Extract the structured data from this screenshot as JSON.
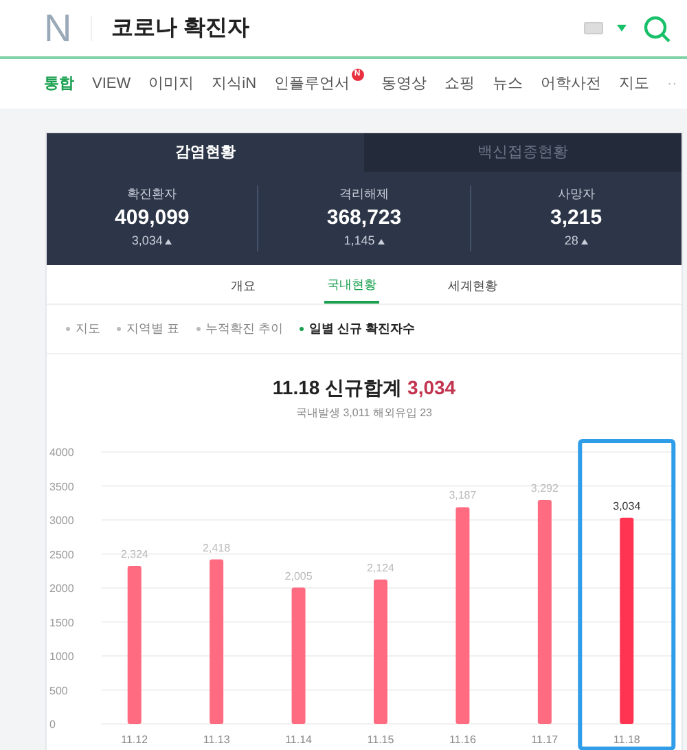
{
  "header": {
    "logo": "N",
    "query": "코로나 확진자"
  },
  "nav_tabs": [
    {
      "label": "통합",
      "selected": true
    },
    {
      "label": "VIEW",
      "selected": false
    },
    {
      "label": "이미지",
      "selected": false
    },
    {
      "label": "지식iN",
      "selected": false
    },
    {
      "label": "인플루언서",
      "selected": false,
      "badge": "N"
    },
    {
      "label": "동영상",
      "selected": false
    },
    {
      "label": "쇼핑",
      "selected": false
    },
    {
      "label": "뉴스",
      "selected": false
    },
    {
      "label": "어학사전",
      "selected": false
    },
    {
      "label": "지도",
      "selected": false
    }
  ],
  "nav_more": "··",
  "card": {
    "top_tabs": [
      {
        "label": "감염현황",
        "selected": true
      },
      {
        "label": "백신접종현황",
        "selected": false
      }
    ],
    "stats": [
      {
        "label": "확진환자",
        "value": "409,099",
        "delta": "3,034"
      },
      {
        "label": "격리해제",
        "value": "368,723",
        "delta": "1,145"
      },
      {
        "label": "사망자",
        "value": "3,215",
        "delta": "28"
      }
    ],
    "sub_tabs": [
      {
        "label": "개요",
        "selected": false
      },
      {
        "label": "국내현황",
        "selected": true
      },
      {
        "label": "세계현황",
        "selected": false
      }
    ],
    "views": [
      {
        "label": "지도",
        "selected": false
      },
      {
        "label": "지역별 표",
        "selected": false
      },
      {
        "label": "누적확진 추이",
        "selected": false
      },
      {
        "label": "일별 신규 확진자수",
        "selected": true
      }
    ],
    "summary": {
      "date": "11.18",
      "title": "신규합계",
      "total": "3,034",
      "domestic_label": "국내발생",
      "domestic": "3,011",
      "overseas_label": "해외유입",
      "overseas": "23"
    },
    "highlight_frame": {
      "shown": true
    },
    "chart_data": {
      "type": "bar",
      "categories": [
        "11.12",
        "11.13",
        "11.14",
        "11.15",
        "11.16",
        "11.17",
        "11.18"
      ],
      "series": [
        {
          "color": "#ff6b80",
          "values": [
            2324,
            2418,
            2005,
            2124,
            3187,
            3292,
            null
          ]
        },
        {
          "color": "#ff3352",
          "values": [
            null,
            null,
            null,
            null,
            null,
            null,
            3034
          ]
        }
      ],
      "ylim": [
        0,
        4000
      ],
      "grid": true,
      "yticks": [
        0,
        500,
        1000,
        1500,
        2000,
        2500,
        3000,
        3500,
        4000
      ],
      "value_labels": [
        "2,324",
        "2,418",
        "2,005",
        "2,124",
        "3,187",
        "3,292",
        "3,034"
      ]
    }
  }
}
